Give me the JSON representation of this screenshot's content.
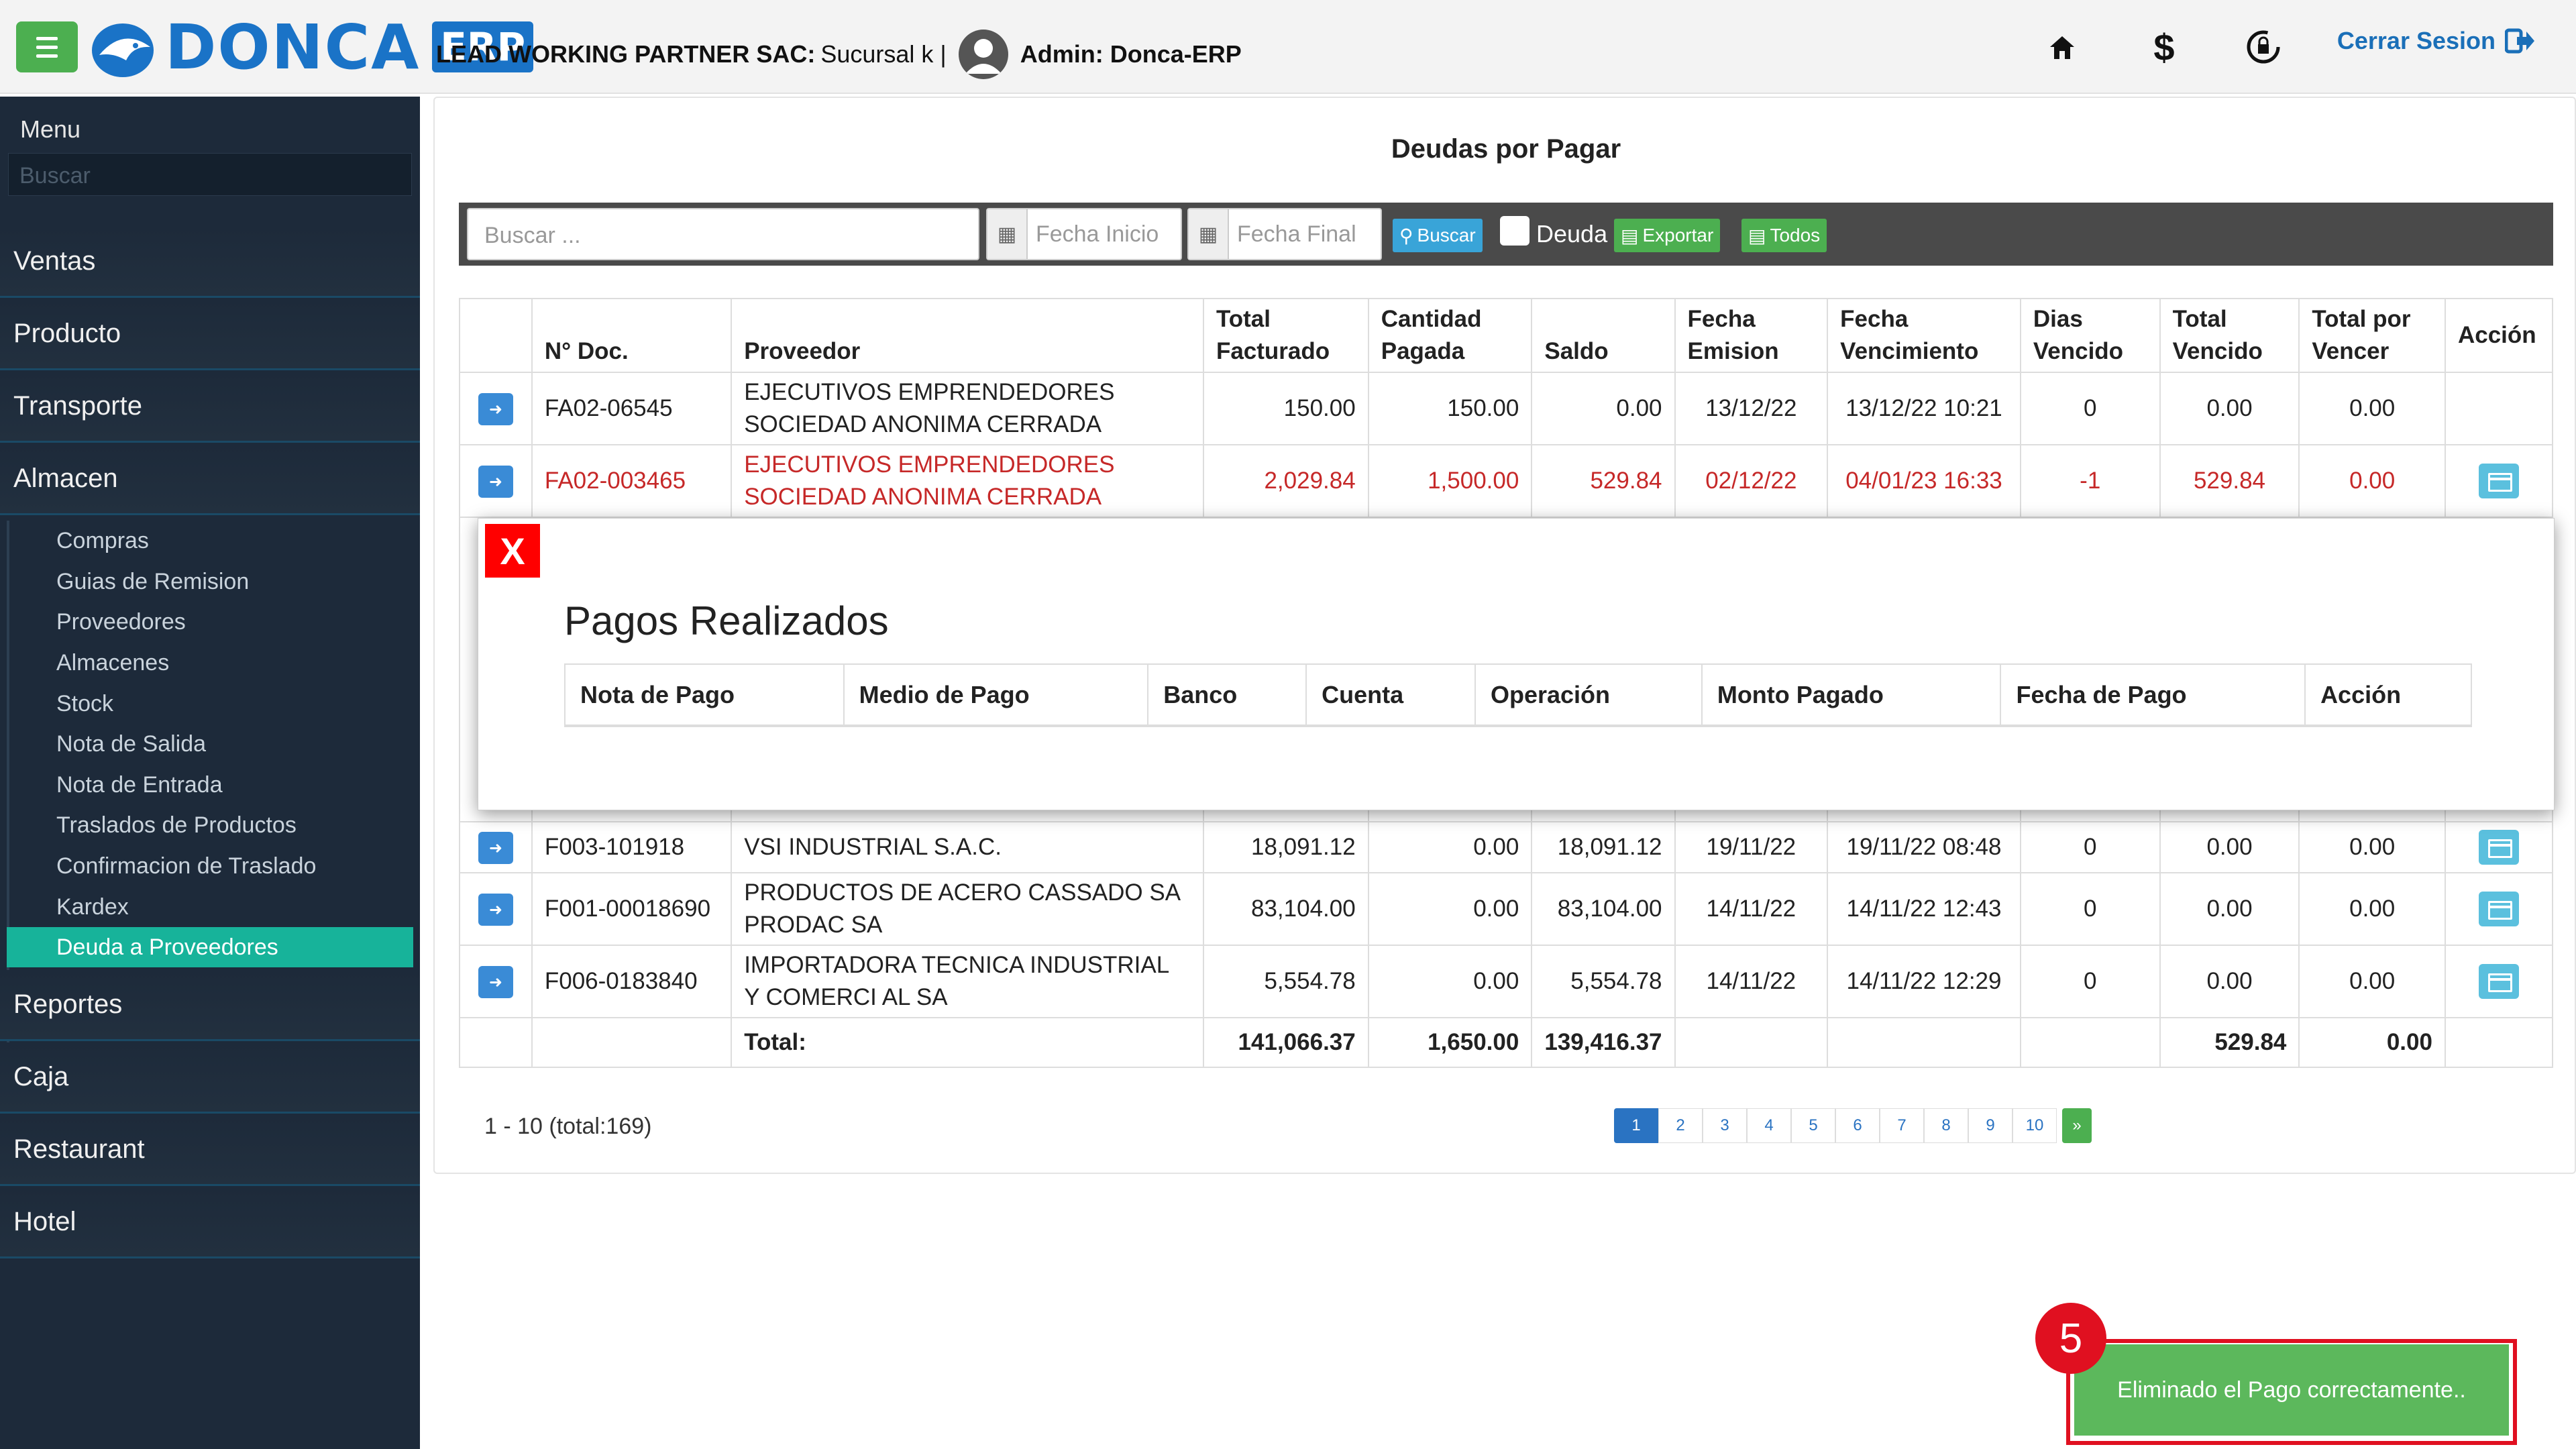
{
  "header": {
    "logo_text": "DONCA",
    "logo_badge": "ERP",
    "company_name": "LEAD WORKING PARTNER SAC:",
    "branch": "Sucursal k |",
    "admin": "Admin: Donca-ERP",
    "logout_label": "Cerrar Sesion",
    "icons": [
      "home-icon",
      "dollar-icon",
      "refresh-lock-icon",
      "logout-icon"
    ]
  },
  "sidebar": {
    "title": "Menu",
    "search_placeholder": "Buscar",
    "items": [
      {
        "label": "Ventas"
      },
      {
        "label": "Producto"
      },
      {
        "label": "Transporte"
      },
      {
        "label": "Almacen"
      },
      {
        "label": "Reportes"
      },
      {
        "label": "Caja"
      },
      {
        "label": "Restaurant"
      },
      {
        "label": "Hotel"
      }
    ],
    "subitems": [
      {
        "label": "Compras"
      },
      {
        "label": "Guias de Remision"
      },
      {
        "label": "Proveedores"
      },
      {
        "label": "Almacenes"
      },
      {
        "label": "Stock"
      },
      {
        "label": "Nota de Salida"
      },
      {
        "label": "Nota de Entrada"
      },
      {
        "label": "Traslados de Productos"
      },
      {
        "label": "Confirmacion de Traslado"
      },
      {
        "label": "Kardex"
      },
      {
        "label": "Deuda a Proveedores"
      }
    ]
  },
  "main": {
    "title": "Deudas por Pagar",
    "toolbar": {
      "search_placeholder": "Buscar ...",
      "date_start_placeholder": "Fecha Inicio",
      "date_end_placeholder": "Fecha Final",
      "search_button": "Buscar",
      "debt_checkbox_label": "Deuda",
      "export_button": "Exportar",
      "all_button": "Todos"
    },
    "table": {
      "headers": {
        "doc": "N° Doc.",
        "supplier": "Proveedor",
        "total_billed_1": "Total",
        "total_billed_2": "Facturado",
        "paid_1": "Cantidad",
        "paid_2": "Pagada",
        "balance": "Saldo",
        "issue_1": "Fecha",
        "issue_2": "Emision",
        "due_1": "Fecha",
        "due_2": "Vencimiento",
        "days_1": "Dias",
        "days_2": "Vencido",
        "overdue_1": "Total",
        "overdue_2": "Vencido",
        "pending_1": "Total por",
        "pending_2": "Vencer",
        "action": "Acción"
      },
      "rows": [
        {
          "doc": "FA02-06545",
          "supplier1": "EJECUTIVOS EMPRENDEDORES",
          "supplier2": "SOCIEDAD ANONIMA CERRADA",
          "billed": "150.00",
          "paid": "150.00",
          "balance": "0.00",
          "issue": "13/12/22",
          "due": "13/12/22 10:21",
          "days": "0",
          "overdue": "0.00",
          "pending": "0.00"
        },
        {
          "doc": "FA02-003465",
          "supplier1": "EJECUTIVOS EMPRENDEDORES",
          "supplier2": "SOCIEDAD ANONIMA CERRADA",
          "billed": "2,029.84",
          "paid": "1,500.00",
          "balance": "529.84",
          "issue": "02/12/22",
          "due": "04/01/23 16:33",
          "days": "-1",
          "overdue": "529.84",
          "pending": "0.00"
        },
        {
          "doc": "F003-101918",
          "supplier1": "VSI INDUSTRIAL S.A.C.",
          "supplier2": "",
          "billed": "18,091.12",
          "paid": "0.00",
          "balance": "18,091.12",
          "issue": "19/11/22",
          "due": "19/11/22 08:48",
          "days": "0",
          "overdue": "0.00",
          "pending": "0.00"
        },
        {
          "doc": "F001-00018690",
          "supplier1": "PRODUCTOS DE ACERO CASSADO SA",
          "supplier2": "PRODAC SA",
          "billed": "83,104.00",
          "paid": "0.00",
          "balance": "83,104.00",
          "issue": "14/11/22",
          "due": "14/11/22 12:43",
          "days": "0",
          "overdue": "0.00",
          "pending": "0.00"
        },
        {
          "doc": "F006-0183840",
          "supplier1": "IMPORTADORA TECNICA INDUSTRIAL",
          "supplier2": "Y COMERCI AL SA",
          "billed": "5,554.78",
          "paid": "0.00",
          "balance": "5,554.78",
          "issue": "14/11/22",
          "due": "14/11/22 12:29",
          "days": "0",
          "overdue": "0.00",
          "pending": "0.00"
        }
      ],
      "totals": {
        "label": "Total:",
        "billed": "141,066.37",
        "paid": "1,650.00",
        "balance": "139,416.37",
        "overdue": "529.84",
        "pending": "0.00"
      }
    },
    "pagination": {
      "info": "1 - 10 (total:169)",
      "pages": [
        "1",
        "2",
        "3",
        "4",
        "5",
        "6",
        "7",
        "8",
        "9",
        "10"
      ],
      "next": "»",
      "current": "1"
    }
  },
  "modal": {
    "close_label": "X",
    "title": "Pagos Realizados",
    "headers": [
      "Nota de Pago",
      "Medio de Pago",
      "Banco",
      "Cuenta",
      "Operación",
      "Monto Pagado",
      "Fecha de Pago",
      "Acción"
    ]
  },
  "toast": {
    "message": "Eliminado el Pago correctamente..",
    "step_number": "5"
  },
  "colors": {
    "brand": "#1a73c7",
    "sidebar_bg": "#1d2a3a",
    "active_item": "#17b39a",
    "overdue_text": "#c62828",
    "toast_bg": "#5cb85c",
    "highlight": "#e01020"
  }
}
